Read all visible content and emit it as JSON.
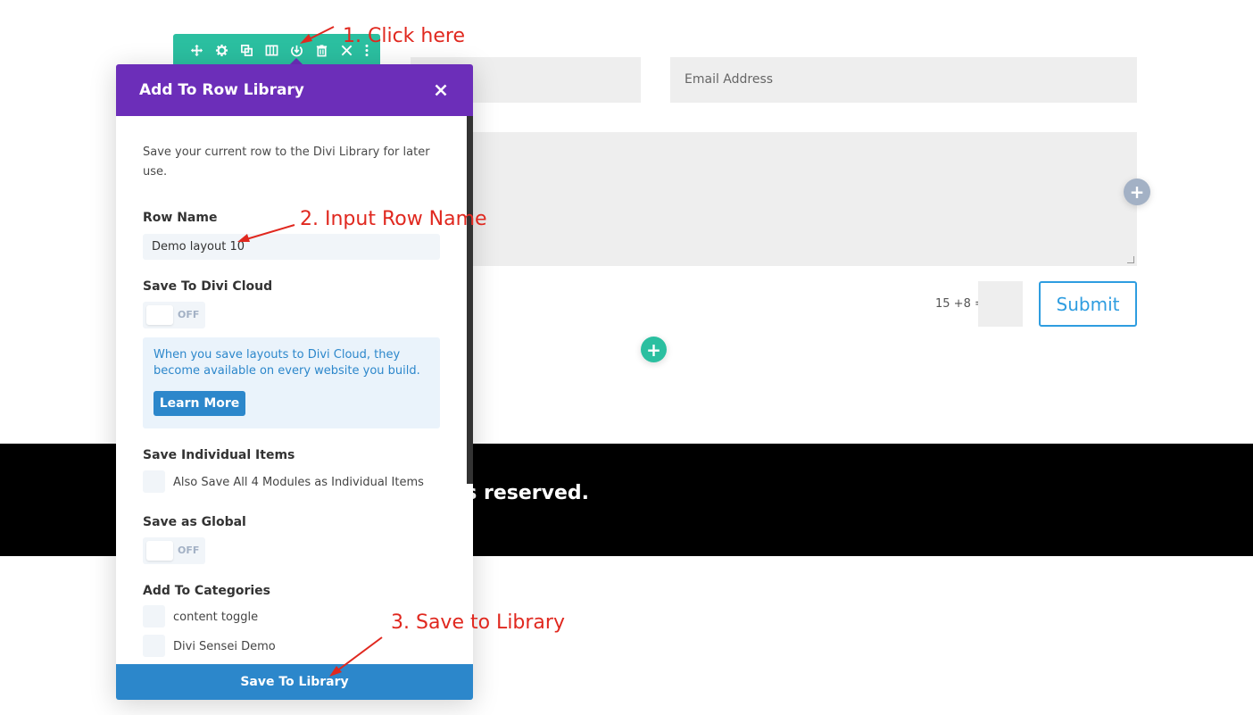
{
  "form": {
    "email_placeholder": "Email Address",
    "captcha_label": "15 +8 =",
    "submit_label": "Submit",
    "add_row_icon": "plus-icon",
    "add_section_icon": "plus-icon"
  },
  "footer": {
    "text_fragment": "s reserved."
  },
  "toolbar": {
    "icons": [
      "move-icon",
      "gear-icon",
      "duplicate-icon",
      "columns-icon",
      "save-to-library-icon",
      "trash-icon",
      "close-icon",
      "more-icon"
    ]
  },
  "modal": {
    "title": "Add To Row Library",
    "intro": "Save your current row to the Divi Library for later use.",
    "row_name_label": "Row Name",
    "row_name_value": "Demo layout 10",
    "cloud_label": "Save To Divi Cloud",
    "cloud_toggle": "OFF",
    "cloud_info": "When you save layouts to Divi Cloud, they become available on every website you build.",
    "learn_more": "Learn More",
    "individual_label": "Save Individual Items",
    "individual_option": "Also Save All 4 Modules as Individual Items",
    "global_label": "Save as Global",
    "global_toggle": "OFF",
    "categories_label": "Add To Categories",
    "categories": [
      "content toggle",
      "Divi Sensei Demo"
    ],
    "save_button": "Save To Library"
  },
  "annotations": {
    "step1": "1. Click here",
    "step2": "2. Input Row Name",
    "step3": "3. Save to Library"
  },
  "colors": {
    "toolbar": "#2bbfa0",
    "modal_header": "#6c2eb9",
    "primary_blue": "#2c87cb",
    "annotation_red": "#e0281f"
  }
}
